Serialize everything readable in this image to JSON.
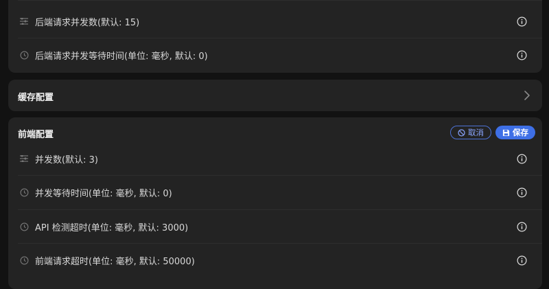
{
  "backend_section": {
    "rows": [
      {
        "label": "后端请求并发数(默认: 15)",
        "icon": "list-icon"
      },
      {
        "label": "后端请求并发等待时间(单位: 毫秒, 默认: 0)",
        "icon": "clock-icon"
      }
    ]
  },
  "cache_section": {
    "title": "缓存配置"
  },
  "frontend_section": {
    "title": "前端配置",
    "cancel_label": "取消",
    "save_label": "保存",
    "rows": [
      {
        "label": "并发数(默认: 3)",
        "icon": "list-icon"
      },
      {
        "label": "并发等待时间(单位: 毫秒, 默认: 0)",
        "icon": "clock-icon"
      },
      {
        "label": "API 检测超时(单位: 毫秒, 默认: 3000)",
        "icon": "clock-icon"
      },
      {
        "label": "前端请求超时(单位: 毫秒, 默认: 50000)",
        "icon": "clock-icon"
      }
    ]
  },
  "colors": {
    "background": "#121212",
    "card": "#232323",
    "accent": "#3e6fe6"
  }
}
